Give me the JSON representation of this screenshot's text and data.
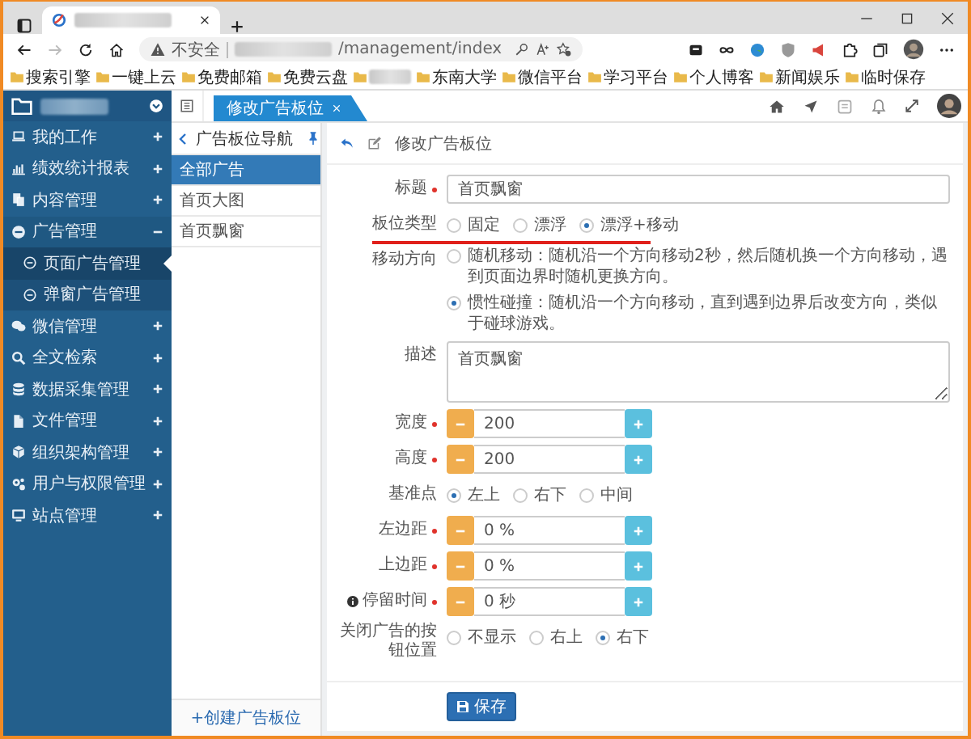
{
  "browser": {
    "address": {
      "security": "不安全",
      "url": "/management/index"
    },
    "bookmarks": [
      {
        "kind": "folder",
        "label": "搜索引擎"
      },
      {
        "kind": "folder",
        "label": "一键上云"
      },
      {
        "kind": "folder",
        "label": "免费邮箱"
      },
      {
        "kind": "folder",
        "label": "免费云盘"
      },
      {
        "kind": "redacted"
      },
      {
        "kind": "folder",
        "label": "东南大学"
      },
      {
        "kind": "folder",
        "label": "微信平台"
      },
      {
        "kind": "folder",
        "label": "学习平台"
      },
      {
        "kind": "folder",
        "label": "个人博客"
      },
      {
        "kind": "folder",
        "label": "新闻娱乐"
      },
      {
        "kind": "folder",
        "label": "临时保存"
      }
    ]
  },
  "sidebar": {
    "items": [
      {
        "label": "我的工作",
        "expanded": false
      },
      {
        "label": "绩效统计报表",
        "expanded": false
      },
      {
        "label": "内容管理",
        "expanded": false
      },
      {
        "label": "广告管理",
        "expanded": true,
        "children": [
          {
            "label": "页面广告管理",
            "selected": true
          },
          {
            "label": "弹窗广告管理",
            "selected": false
          }
        ]
      },
      {
        "label": "微信管理",
        "expanded": false
      },
      {
        "label": "全文检索",
        "expanded": false
      },
      {
        "label": "数据采集管理",
        "expanded": false
      },
      {
        "label": "文件管理",
        "expanded": false
      },
      {
        "label": "组织架构管理",
        "expanded": false
      },
      {
        "label": "用户与权限管理",
        "expanded": false
      },
      {
        "label": "站点管理",
        "expanded": false
      }
    ]
  },
  "tabs": [
    {
      "label": "修改广告板位",
      "selected": true
    }
  ],
  "nav": {
    "title": "广告板位导航",
    "items": [
      {
        "label": "全部广告",
        "selected": true
      },
      {
        "label": "首页大图",
        "selected": false
      },
      {
        "label": "首页飘窗",
        "selected": false
      }
    ],
    "create": "+创建广告板位"
  },
  "form": {
    "title": "修改广告板位",
    "fields": [
      {
        "kind": "text",
        "label": "标题",
        "required": true,
        "value": "首页飘窗"
      },
      {
        "kind": "radio",
        "label": "板位类型",
        "underlined": true,
        "options": [
          {
            "label": "固定",
            "selected": false
          },
          {
            "label": "漂浮",
            "selected": false
          },
          {
            "label": "漂浮+移动",
            "selected": true
          }
        ]
      },
      {
        "kind": "radio-list",
        "label": "移动方向",
        "options": [
          {
            "label": "随机移动：随机沿一个方向移动2秒，然后随机换一个方向移动，遇到页面边界时随机更换方向。",
            "selected": false
          },
          {
            "label": "惯性碰撞：随机沿一个方向移动，直到遇到边界后改变方向，类似于碰球游戏。",
            "selected": true
          }
        ]
      },
      {
        "kind": "textarea",
        "label": "描述",
        "value": "首页飘窗"
      },
      {
        "kind": "spinner",
        "label": "宽度",
        "required": true,
        "value": "200"
      },
      {
        "kind": "spinner",
        "label": "高度",
        "required": true,
        "value": "200"
      },
      {
        "kind": "radio",
        "label": "基准点",
        "options": [
          {
            "label": "左上",
            "selected": true
          },
          {
            "label": "右下",
            "selected": false
          },
          {
            "label": "中间",
            "selected": false
          }
        ]
      },
      {
        "kind": "spinner",
        "label": "左边距",
        "required": true,
        "value": "0 %"
      },
      {
        "kind": "spinner",
        "label": "上边距",
        "required": true,
        "value": "0 %"
      },
      {
        "kind": "spinner",
        "label": "停留时间",
        "required": true,
        "info": true,
        "value": "0 秒"
      },
      {
        "kind": "radio",
        "label": "关闭广告的按钮位置",
        "options": [
          {
            "label": "不显示",
            "selected": false
          },
          {
            "label": "右上",
            "selected": false
          },
          {
            "label": "右下",
            "selected": true
          }
        ]
      }
    ],
    "save": "保存"
  }
}
